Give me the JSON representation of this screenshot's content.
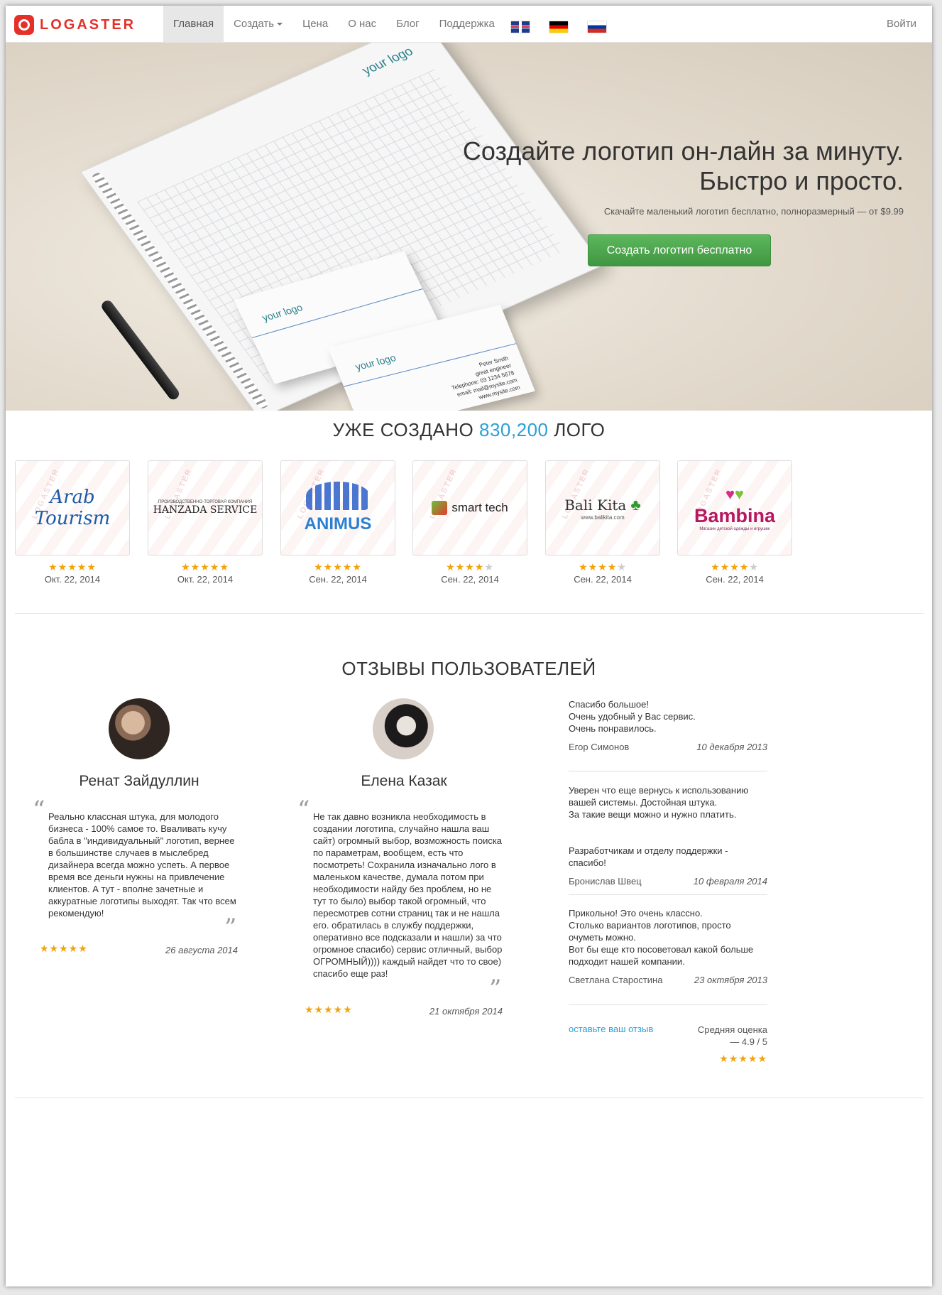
{
  "nav": {
    "brand": "LOGASTER",
    "items": [
      {
        "label": "Главная"
      },
      {
        "label": "Создать"
      },
      {
        "label": "Цена"
      },
      {
        "label": "О нас"
      },
      {
        "label": "Блог"
      },
      {
        "label": "Поддержка"
      }
    ],
    "flags": [
      "uk-flag-icon",
      "de-flag-icon",
      "ru-flag-icon"
    ],
    "login": "Войти"
  },
  "hero": {
    "title_line1": "Создайте логотип он-лайн за минуту.",
    "title_line2": "Быстро и просто.",
    "subtitle": "Скачайте маленький логотип бесплатно, полноразмерный — от $9.99",
    "cta": "Создать логотип бесплатно",
    "notebook_logo": "your logo",
    "card_logo": "your logo",
    "card_name": "Peter Smith",
    "card_role": "great engineer",
    "card_phone": "Telephone: 03 1234 5678",
    "card_email": "email: mail@mysite.com",
    "card_site": "www.mysite.com",
    "pen_logo": "your logo"
  },
  "counter": {
    "prefix": "УЖЕ СОЗДАНО",
    "number": "830,200",
    "suffix": "ЛОГО"
  },
  "logos": [
    {
      "name": "Arab Tourism",
      "stars": "★★★★★",
      "date": "Окт. 22, 2014"
    },
    {
      "name": "HANZADA SERVICE",
      "tagline": "ПРОИЗВОДСТВЕННО-ТОРГОВАЯ КОМПАНИЯ",
      "stars": "★★★★★",
      "date": "Окт. 22, 2014"
    },
    {
      "name": "ANIMUS",
      "stars": "★★★★★",
      "date": "Сен. 22, 2014"
    },
    {
      "name": "smart tech",
      "stars": "★★★★",
      "stars_off": "★",
      "date": "Сен. 22, 2014"
    },
    {
      "name": "Bali Kita",
      "tagline": "www.balikita.com",
      "stars": "★★★★",
      "stars_off": "★",
      "date": "Сен. 22, 2014"
    },
    {
      "name": "Bambina",
      "tagline": "Магазин детской одежды и игрушек",
      "stars": "★★★★",
      "stars_off": "★",
      "date": "Сен. 22, 2014"
    }
  ],
  "watermark": "LOGASTER",
  "reviews": {
    "title": "ОТЗЫВЫ ПОЛЬЗОВАТЕЛЕЙ",
    "quote_open": "“",
    "quote_close": "”",
    "featured": [
      {
        "name": "Ренат Зайдуллин",
        "text": "Реально классная штука, для молодого бизнеса - 100% самое то. Вваливать кучу бабла в \"индивидуальный\" логотип, вернее в большинстве случаев в мыслебред дизайнера всегда можно успеть. А первое время все деньги нужны на привлечение клиентов. А тут - вполне зачетные и аккуратные логотипы выходят. Так что всем рекомендую!",
        "stars": "★★★★★",
        "date": "26 августа 2014"
      },
      {
        "name": "Елена Казак",
        "text": "Не так давно возникла необходимость в создании логотипа, случайно нашла ваш сайт) огромный выбор, возможность поиска по параметрам, вообщем, есть что посмотреть! Сохранила изначально лого в маленьком качестве, думала потом при необходимости найду без проблем, но не тут то было) выбор такой огромный, что пересмотрев сотни страниц так и не нашла его. обратилась в службу поддержки, оперативно все подсказали и нашли) за что огромное спасибо) сервис отличный, выбор ОГРОМНЫЙ)))) каждый найдет что то свое) спасибо еще раз!",
        "stars": "★★★★★",
        "date": "21 октября 2014"
      }
    ],
    "short": [
      {
        "lines": [
          "Спасибо большое!",
          "Очень удобный у Вас сервис.",
          "Очень понравилось."
        ],
        "author": "Егор Симонов",
        "date": "10 декабря 2013"
      },
      {
        "lines": [
          "Уверен что еще вернусь к использованию вашей системы. Достойная штука.",
          "За такие вещи можно и нужно платить.",
          "",
          "Разработчикам и отделу поддержки - спасибо!"
        ],
        "author": "Бронислав Швец",
        "date": "10 февраля 2014"
      },
      {
        "lines": [
          "Прикольно! Это очень классно.",
          "Столько вариантов логотипов, просто очуметь можно.",
          "Вот бы еще кто посоветовал какой больше подходит нашей компании."
        ],
        "author": "Светлана Старостина",
        "date": "23 октября 2013"
      }
    ],
    "leave_link": "оставьте ваш отзыв",
    "average_label": "Средняя оценка — 4.9 / 5",
    "average_stars": "★★★★★"
  }
}
